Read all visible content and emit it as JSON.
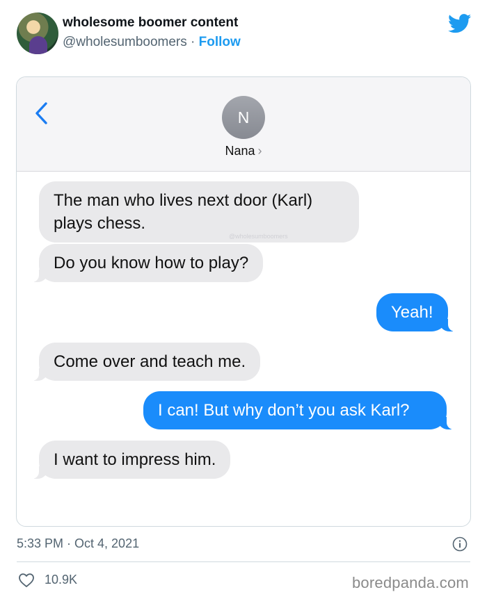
{
  "tweet": {
    "author_name": "wholesome boomer content",
    "handle": "@wholesumboomers",
    "separator": " · ",
    "follow_label": "Follow",
    "timestamp": "5:33 PM · Oct 4, 2021",
    "like_count": "10.9K",
    "source_logo": "boredpanda.com",
    "icons": {
      "brand": "twitter-bird-icon",
      "info": "info-icon",
      "like": "heart-icon"
    },
    "colors": {
      "accent": "#1d9bf0",
      "muted": "#536471"
    }
  },
  "conversation": {
    "contact_initial": "N",
    "contact_name": "Nana",
    "contact_chevron": "›",
    "watermark": "@wholesumboomers",
    "colors": {
      "incoming": "#e9e9eb",
      "outgoing": "#1a8cfb"
    },
    "messages": [
      {
        "from": "contact",
        "text": "The man who lives next door (Karl) plays chess."
      },
      {
        "from": "contact",
        "text": "Do you know how to play?"
      },
      {
        "from": "me",
        "text": "Yeah!"
      },
      {
        "from": "contact",
        "text": "Come over and teach me."
      },
      {
        "from": "me",
        "text": "I can! But why don’t you ask Karl?"
      },
      {
        "from": "contact",
        "text": "I want to impress him."
      }
    ]
  }
}
